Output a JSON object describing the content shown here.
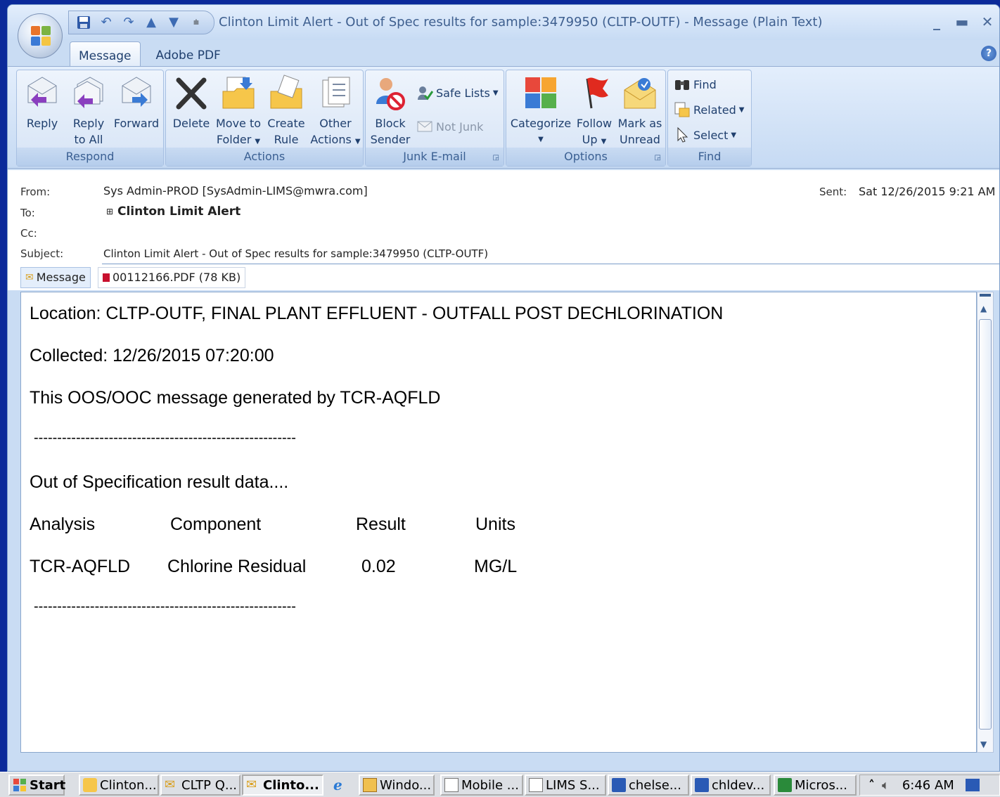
{
  "window": {
    "title": "Clinton Limit Alert - Out of Spec results for sample:3479950 (CLTP-OUTF)  - Message (Plain Text)",
    "tabs": [
      {
        "label": "Message"
      },
      {
        "label": "Adobe PDF"
      }
    ]
  },
  "ribbon": {
    "respond": {
      "label": "Respond",
      "reply": "Reply",
      "reply_all_1": "Reply",
      "reply_all_2": "to All",
      "forward": "Forward"
    },
    "actions": {
      "label": "Actions",
      "delete": "Delete",
      "move_1": "Move to",
      "move_2": "Folder",
      "create_1": "Create",
      "create_2": "Rule",
      "other_1": "Other",
      "other_2": "Actions"
    },
    "junk": {
      "label": "Junk E-mail",
      "block_1": "Block",
      "block_2": "Sender",
      "safe_lists": "Safe Lists",
      "not_junk": "Not Junk"
    },
    "options": {
      "label": "Options",
      "categorize": "Categorize",
      "follow_1": "Follow",
      "follow_2": "Up",
      "mark_1": "Mark as",
      "mark_2": "Unread"
    },
    "find": {
      "label": "Find",
      "find": "Find",
      "related": "Related",
      "select": "Select"
    }
  },
  "header": {
    "from_label": "From:",
    "from": "Sys Admin-PROD [SysAdmin-LIMS@mwra.com]",
    "to_label": "To:",
    "to": "Clinton Limit Alert",
    "cc_label": "Cc:",
    "subject_label": "Subject:",
    "subject": "Clinton Limit Alert - Out of Spec results for sample:3479950 (CLTP-OUTF)",
    "sent_label": "Sent:",
    "sent": "Sat 12/26/2015 9:21 AM"
  },
  "attachments": {
    "message_tab": "Message",
    "pdf": "00112166.PDF (78 KB)"
  },
  "body": {
    "location": "Location: CLTP-OUTF, FINAL PLANT EFFLUENT - OUTFALL POST DECHLORINATION",
    "collected": "Collected: 12/26/2015 07:20:00",
    "generated": "This OOS/OOC message generated by TCR-AQFLD",
    "separator": "--------------------------------------------------------",
    "oos_heading": "Out of Specification result data....",
    "col_analysis": "Analysis",
    "col_component": "Component",
    "col_result": "Result",
    "col_units": "Units",
    "row_analysis": "TCR-AQFLD",
    "row_component": "Chlorine Residual",
    "row_result": "0.02",
    "row_units": "MG/L"
  },
  "taskbar": {
    "start": "Start",
    "items": [
      {
        "label": "Clinton..."
      },
      {
        "label": "CLTP Q..."
      },
      {
        "label": "Clinto..."
      },
      {
        "label": "Windo..."
      },
      {
        "label": "Mobile ..."
      },
      {
        "label": "LIMS S..."
      },
      {
        "label": "chelse..."
      },
      {
        "label": "chldev..."
      },
      {
        "label": "Micros..."
      }
    ],
    "clock": "6:46 AM"
  }
}
